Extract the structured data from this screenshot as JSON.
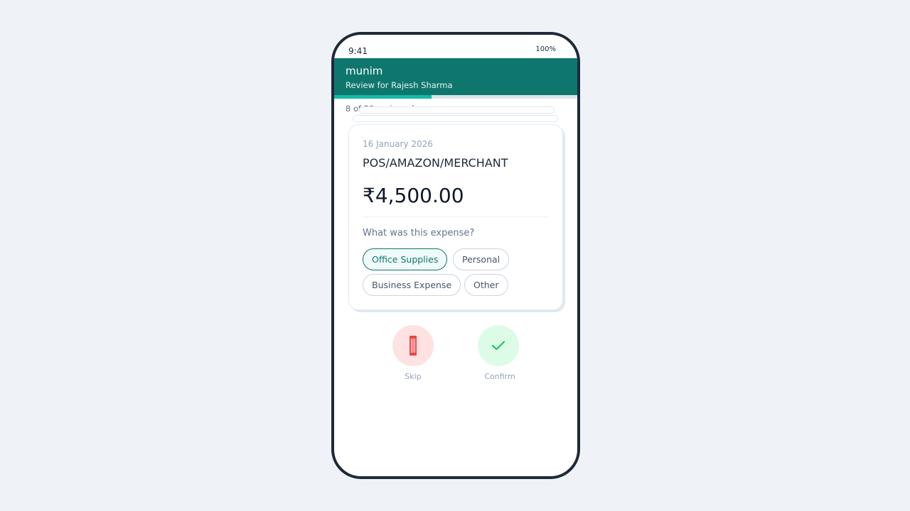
{
  "status_bar": {
    "time": "9:41",
    "battery": "100%"
  },
  "header": {
    "title": "munim",
    "subtitle": "Review for Rajesh Sharma"
  },
  "progress": {
    "fraction": 0.4,
    "text": "8 of 20 reviewed"
  },
  "transaction": {
    "date": "16 January 2026",
    "merchant": "POS/AMAZON/MERCHANT",
    "amount": "₹4,500.00"
  },
  "question": "What was this expense?",
  "categories": [
    {
      "label": "Office Supplies",
      "selected": true
    },
    {
      "label": "Personal",
      "selected": false
    },
    {
      "label": "Business Expense",
      "selected": false
    },
    {
      "label": "Other",
      "selected": false
    }
  ],
  "actions": {
    "skip": {
      "label": "Skip",
      "icon": "trash-icon",
      "color": "#ef4444"
    },
    "confirm": {
      "label": "Confirm",
      "icon": "check-icon",
      "color": "#22c55e"
    }
  },
  "colors": {
    "brand": "#0f766e",
    "progress": "#14b8a6",
    "background": "#eff3f8"
  }
}
